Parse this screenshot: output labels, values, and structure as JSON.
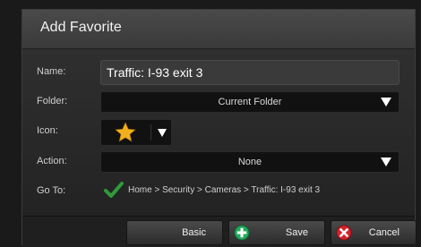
{
  "dialog": {
    "title": "Add Favorite"
  },
  "fields": {
    "name": {
      "label": "Name:",
      "value": "Traffic: I-93 exit 3"
    },
    "folder": {
      "label": "Folder:",
      "value": "Current Folder"
    },
    "icon": {
      "label": "Icon:",
      "icon": "star-icon"
    },
    "action": {
      "label": "Action:",
      "value": "None"
    },
    "goto": {
      "label": "Go To:",
      "path": "Home > Security > Cameras > Traffic: I-93 exit 3",
      "icon": "checkmark-icon"
    }
  },
  "buttons": {
    "basic": {
      "label": "Basic"
    },
    "save": {
      "label": "Save",
      "icon": "plus-icon",
      "color": "#22a95a"
    },
    "cancel": {
      "label": "Cancel",
      "icon": "close-icon",
      "color": "#d4242b"
    }
  },
  "colors": {
    "star": "#f2b01c",
    "check": "#2f9b3a"
  }
}
